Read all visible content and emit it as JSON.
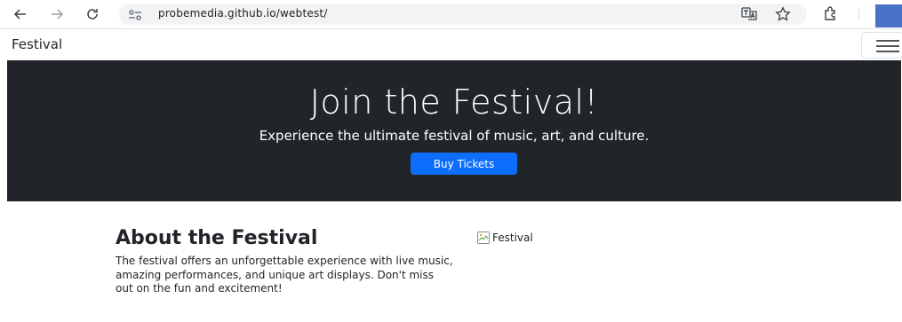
{
  "browser": {
    "url": "probemedia.github.io/webtest/",
    "icons": [
      "back-arrow-icon",
      "forward-arrow-icon",
      "reload-icon",
      "site-info-icon",
      "translate-icon",
      "star-icon",
      "extensions-icon"
    ]
  },
  "navbar": {
    "brand": "Festival"
  },
  "hero": {
    "title": "Join the Festival!",
    "subtitle": "Experience the ultimate festival of music, art, and culture.",
    "button_label": "Buy Tickets",
    "background_color": "#212529",
    "button_color": "#0d6efd"
  },
  "about": {
    "heading": "About the Festival",
    "body": "The festival offers an unforgettable experience with live music, amazing performances, and unique art displays. Don't miss out on the fun and excitement!",
    "image_alt": "Festival"
  }
}
